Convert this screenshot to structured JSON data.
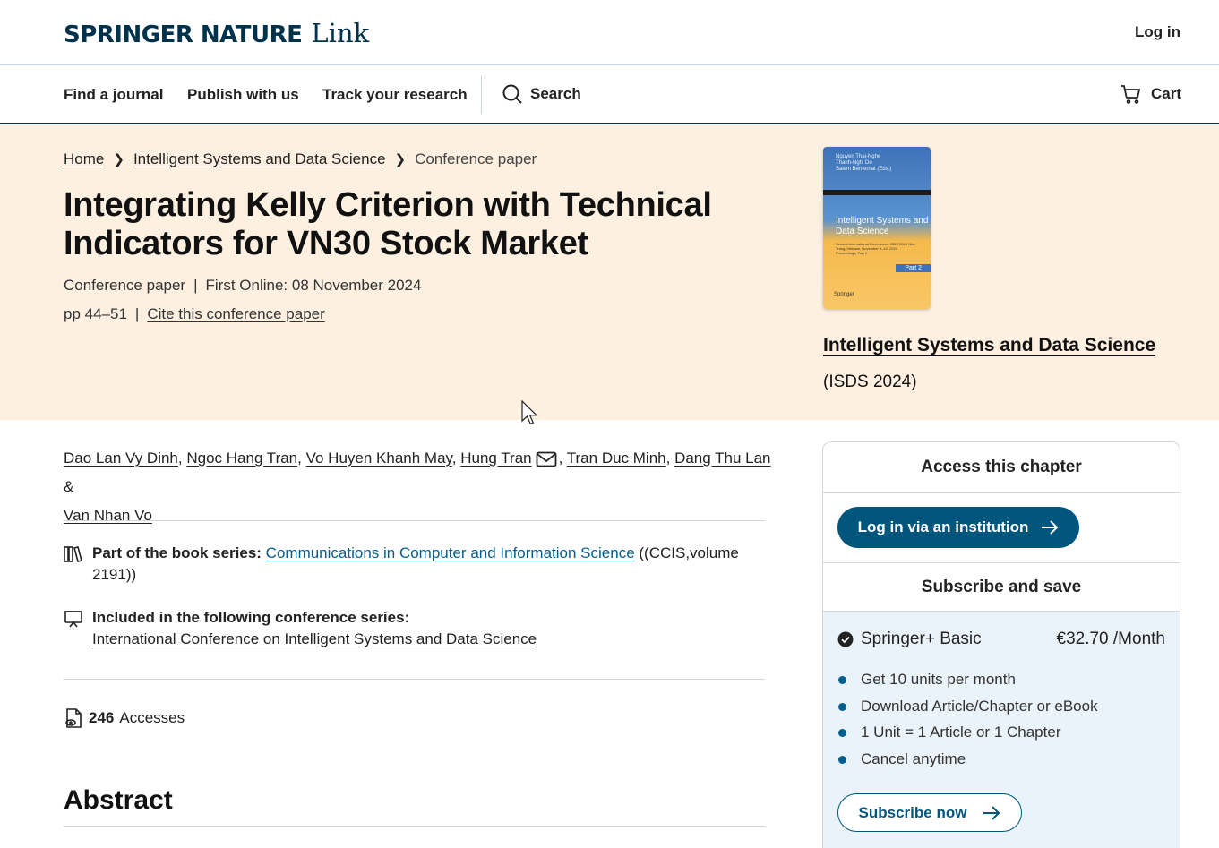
{
  "header": {
    "logo_brand": "SPRINGER NATURE",
    "logo_product": "Link",
    "login_label": "Log in"
  },
  "nav": {
    "items": [
      "Find a journal",
      "Publish with us",
      "Track your research"
    ],
    "search_label": "Search",
    "cart_label": "Cart"
  },
  "breadcrumb": {
    "items": [
      "Home",
      "Intelligent Systems and Data Science"
    ],
    "current": "Conference paper"
  },
  "article": {
    "title": "Integrating Kelly Criterion with Technical Indicators for VN30 Stock Market",
    "type": "Conference paper",
    "first_online": "First Online: 08 November 2024",
    "pages": "pp 44–51",
    "cite_label": "Cite this conference paper"
  },
  "book": {
    "title": "Intelligent Systems and Data Science",
    "acronym": "(ISDS 2024)",
    "cover": {
      "authors": [
        "Nguyen Thai-Nghe",
        "Thanh-Nghi Do",
        "Salem Benferhat (Eds.)"
      ],
      "title": "Intelligent Systems and Data Science",
      "subtitle": "Second International Conference, ISDS 2024 Nha Trang, Vietnam, November 9–10, 2024 Proceedings, Part II",
      "part": "Part 2",
      "publisher": "Springer"
    }
  },
  "authors": {
    "names": [
      "Dao Lan Vy Dinh",
      "Ngoc Hang Tran",
      "Vo Huyen Khanh May",
      "Hung Tran",
      "Tran Duc Minh",
      "Dang Thu Lan",
      "Van Nhan Vo"
    ]
  },
  "series": {
    "book_series_label": "Part of the book series:",
    "book_series_link": "Communications in Computer and Information Science",
    "book_series_suffix": "((CCIS,volume 2191))",
    "conf_series_label": "Included in the following conference series:",
    "conf_series_link": "International Conference on Intelligent Systems and Data Science"
  },
  "metrics": {
    "accesses_count": "246",
    "accesses_label": "Accesses"
  },
  "abstract": {
    "heading": "Abstract"
  },
  "access_panel": {
    "heading": "Access this chapter",
    "login_institution": "Log in via an institution",
    "subscribe_heading": "Subscribe and save",
    "plan_name": "Springer+ Basic",
    "plan_price": "€32.70 /Month",
    "features": [
      "Get 10 units per month",
      "Download Article/Chapter or eBook",
      "1 Unit = 1 Article or 1 Chapter",
      "Cancel anytime"
    ],
    "subscribe_button": "Subscribe now"
  },
  "colors": {
    "brand_navy": "#01324b",
    "link_blue": "#025e8d",
    "button_blue": "#01567d",
    "hero_bg": "#fdf0e1",
    "plan_bg": "#ebf3fa"
  }
}
